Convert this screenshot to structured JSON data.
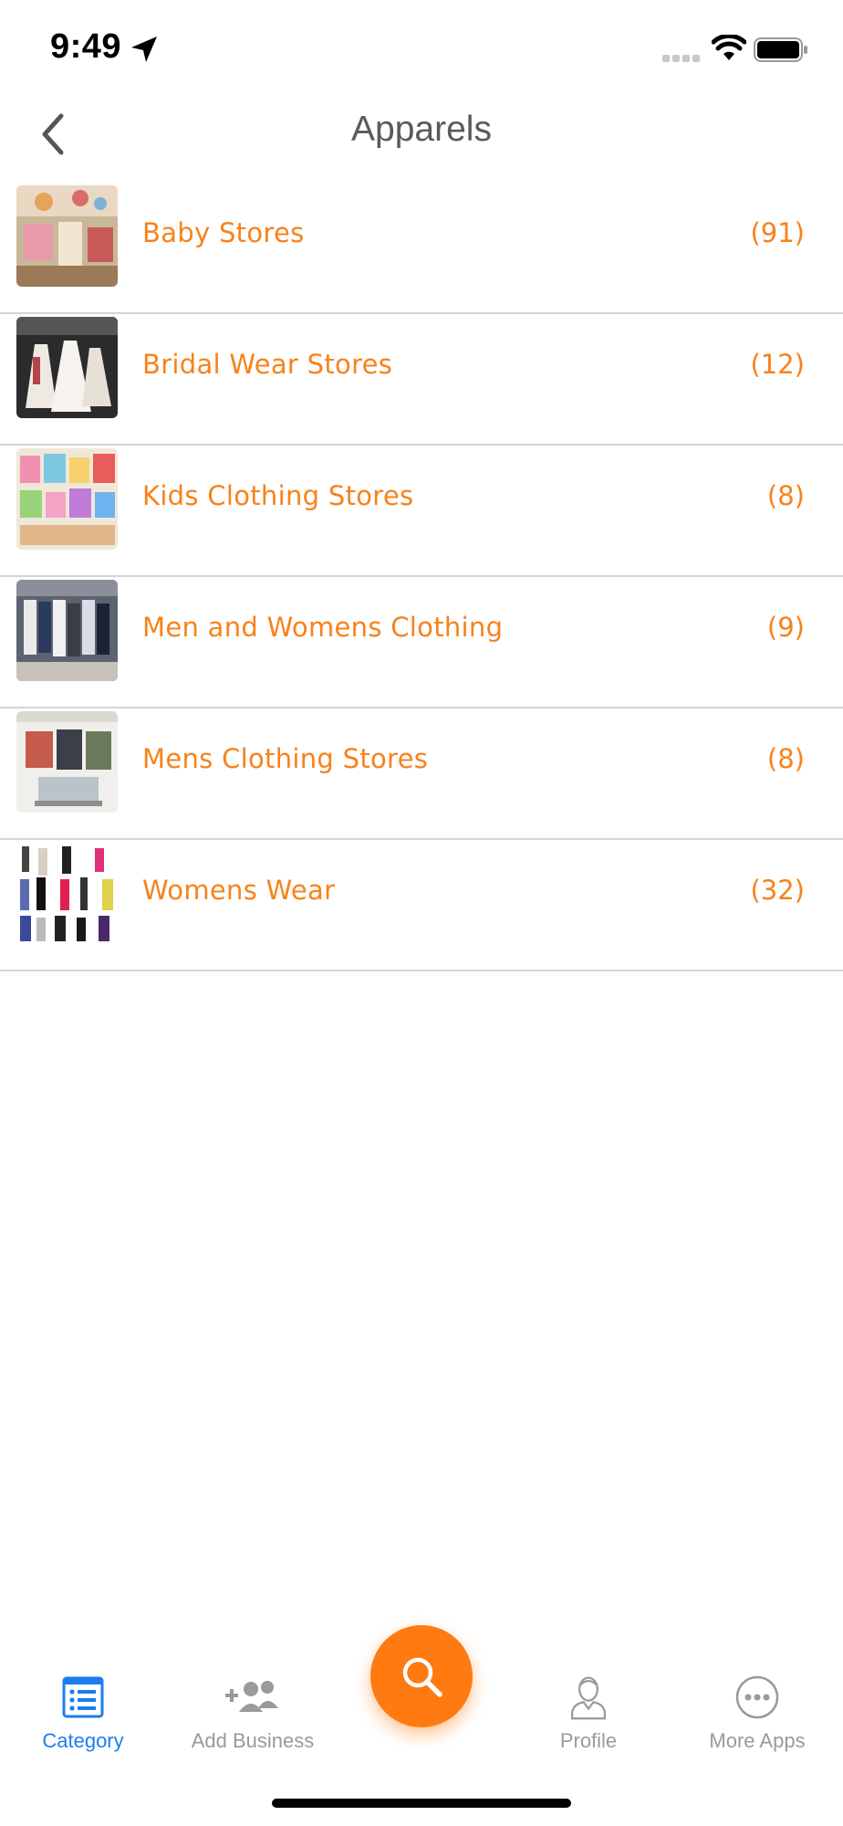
{
  "status_bar": {
    "time": "9:49",
    "icons": [
      "location-arrow-icon",
      "cellular-signal-icon",
      "wifi-icon",
      "battery-icon"
    ]
  },
  "nav": {
    "title": "Apparels",
    "back_icon": "chevron-left-icon"
  },
  "categories": [
    {
      "label": "Baby Stores",
      "count": "(91)"
    },
    {
      "label": "Bridal Wear Stores",
      "count": "(12)"
    },
    {
      "label": "Kids Clothing Stores",
      "count": "(8)"
    },
    {
      "label": "Men and Womens Clothing",
      "count": "(9)"
    },
    {
      "label": "Mens Clothing Stores",
      "count": "(8)"
    },
    {
      "label": "Womens Wear",
      "count": "(32)"
    }
  ],
  "tab_bar": {
    "tabs": [
      {
        "label": "Category",
        "icon": "list-icon",
        "active": true
      },
      {
        "label": "Add Business",
        "icon": "add-users-icon",
        "active": false
      },
      {
        "label": "Profile",
        "icon": "user-icon",
        "active": false
      },
      {
        "label": "More Apps",
        "icon": "more-dots-icon",
        "active": false
      }
    ],
    "center_action_icon": "search-icon"
  },
  "colors": {
    "accent": "#f7821b",
    "fab": "#ff7a10",
    "active_tab": "#1b7ef0",
    "inactive_tab": "#9a9a9a",
    "title": "#5a5a5a",
    "divider": "#d4d4d4"
  }
}
